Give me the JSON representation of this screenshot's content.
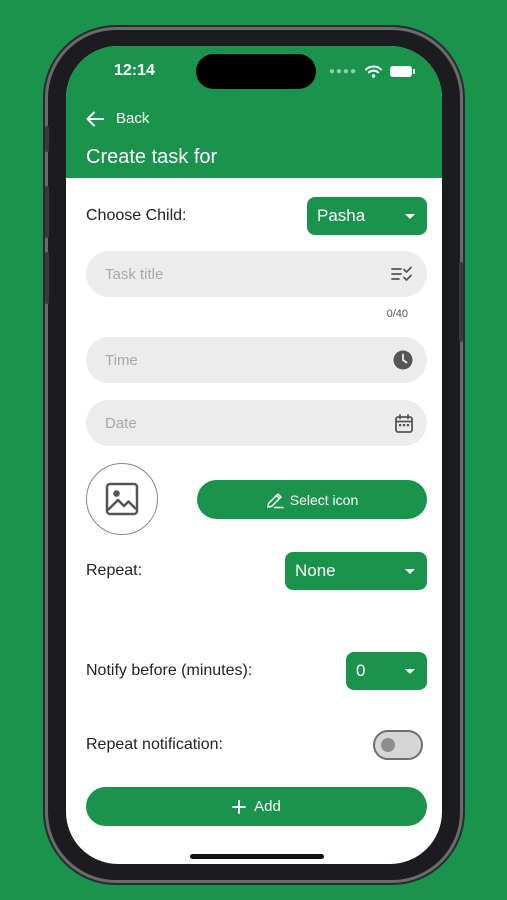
{
  "status_bar": {
    "time": "12:14"
  },
  "header": {
    "back_label": "Back",
    "title": "Create task for"
  },
  "form": {
    "choose_child_label": "Choose Child:",
    "child_value": "Pasha",
    "task_title_placeholder": "Task title",
    "task_title_counter": "0/40",
    "time_placeholder": "Time",
    "date_placeholder": "Date",
    "select_icon_label": "Select icon",
    "repeat_label": "Repeat:",
    "repeat_value": "None",
    "notify_label": "Notify before (minutes):",
    "notify_value": "0",
    "repeat_notification_label": "Repeat notification:",
    "repeat_notification_on": false,
    "add_label": "Add"
  },
  "colors": {
    "accent": "#1a944d",
    "field_bg": "#ececec"
  },
  "icons": {
    "back": "arrow-left-icon",
    "task_title": "checklist-icon",
    "time": "clock-icon",
    "date": "calendar-icon",
    "image": "image-icon",
    "select_icon": "pencil-icon",
    "add": "plus-icon"
  }
}
